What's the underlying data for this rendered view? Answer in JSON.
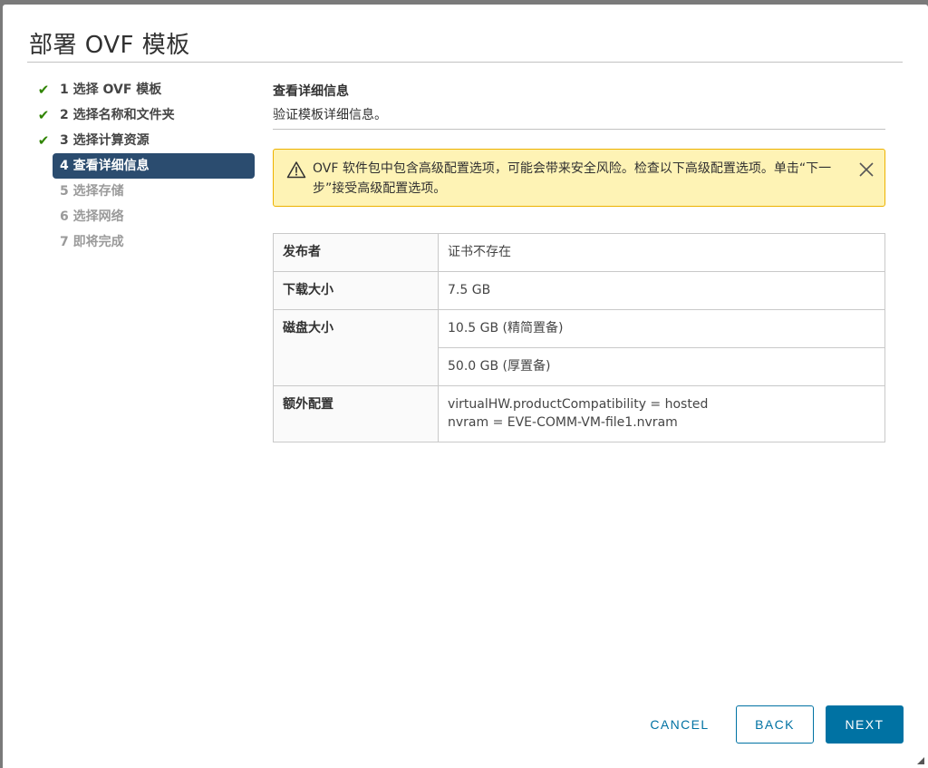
{
  "dialog": {
    "title": "部署 OVF 模板"
  },
  "steps": [
    {
      "label": "1 选择 OVF 模板",
      "state": "done"
    },
    {
      "label": "2 选择名称和文件夹",
      "state": "done"
    },
    {
      "label": "3 选择计算资源",
      "state": "done"
    },
    {
      "label": "4 查看详细信息",
      "state": "active"
    },
    {
      "label": "5 选择存储",
      "state": "pending"
    },
    {
      "label": "6 选择网络",
      "state": "pending"
    },
    {
      "label": "7 即将完成",
      "state": "pending"
    }
  ],
  "content": {
    "heading": "查看详细信息",
    "subtitle": "验证模板详细信息。"
  },
  "alert": {
    "icon": "warning-icon",
    "message": "OVF 软件包中包含高级配置选项，可能会带来安全风险。检查以下高级配置选项。单击“下一步”接受高级配置选项。"
  },
  "details": {
    "publisher": {
      "label": "发布者",
      "value": "证书不存在"
    },
    "download_size": {
      "label": "下载大小",
      "value": "7.5 GB"
    },
    "disk_size": {
      "label": "磁盘大小",
      "thin": "10.5 GB (精简置备)",
      "thick": "50.0 GB (厚置备)"
    },
    "extra_config": {
      "label": "额外配置",
      "line1": "virtualHW.productCompatibility = hosted",
      "line2": "nvram = EVE-COMM-VM-file1.nvram"
    }
  },
  "footer": {
    "cancel": "CANCEL",
    "back": "BACK",
    "next": "NEXT"
  },
  "colors": {
    "check": "#2f8400",
    "active_step": "#2b4c6f",
    "alert_bg": "#fef3b5",
    "alert_border": "#edb200",
    "primary": "#0072a3"
  }
}
